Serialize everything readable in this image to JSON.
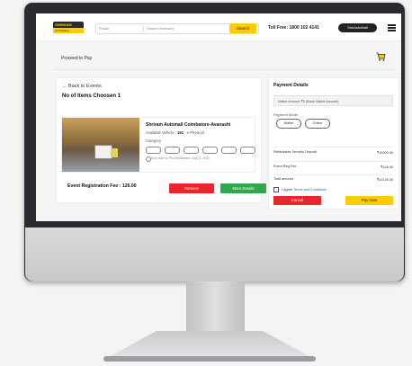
{
  "header": {
    "logo_name": "SHRIRAM",
    "logo_sub": "AUTOMALL",
    "state_label": "Pokaz",
    "search_placeholder": "Search Inventory",
    "search_button": "Search",
    "toll_free": "Toll Free: 1800 102 4141",
    "user_label": "ShriAutoMall",
    "colors": {
      "accent": "#ffcc00",
      "dark": "#222222"
    }
  },
  "page": {
    "breadcrumb": "Proceed to Pay"
  },
  "left": {
    "back_link": "← Back to Events",
    "items_title": "No of Items Choosen 1",
    "event": {
      "name": "Shriram Automall Coimbatore-Avanashi",
      "available_label": "Available Vehicle :",
      "available_count": "151",
      "type": "Physical",
      "category_label": "Category",
      "date": "Kick start to Pro-installation: Sep 5, 2022"
    },
    "reg_fee": "Event Registration Fee : 126.00",
    "remove_button": "Remove",
    "more_button": "More Details"
  },
  "payment": {
    "title": "Payment Details",
    "wallet_text": "Wallet Amount ₹0 (Bank Wallet Amount)",
    "mode_label": "Payment Mode",
    "mode_wallet": "Wallet",
    "mode_online": "Online",
    "rows": [
      {
        "label": "Refundable Security Deposit",
        "value": "₹10000.00"
      },
      {
        "label": "Event Reg Fee",
        "value": "₹126.00"
      },
      {
        "label": "Total amount",
        "value": "₹10126.00"
      }
    ],
    "terms_prefix": "I Agree",
    "terms_link": "Terms and Conditions",
    "cancel_button": "Cancel",
    "pay_button": "Pay Now",
    "colors": {
      "cancel": "#e8262c",
      "pay": "#ffcc00",
      "more": "#2fa84f"
    }
  }
}
